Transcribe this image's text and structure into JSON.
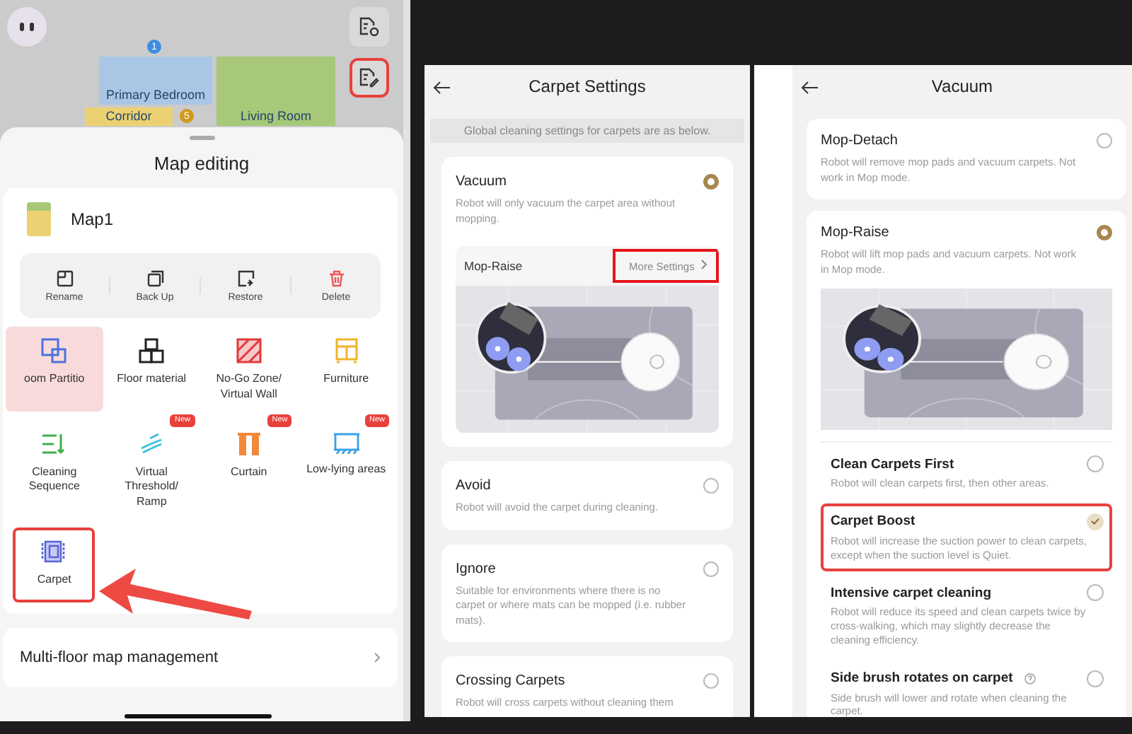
{
  "map_screen": {
    "rooms": [
      {
        "name": "Primary Bedroom",
        "color": "#a9c6e4"
      },
      {
        "name": "Corridor",
        "color": "#ecd172"
      },
      {
        "name": "Living Room",
        "color": "#a6c878"
      }
    ],
    "markers": [
      {
        "label": "1",
        "color": "#3d8ee0"
      },
      {
        "label": "5",
        "color": "#d09a1c"
      }
    ],
    "tools": [
      {
        "kind": "view",
        "highlighted": false
      },
      {
        "kind": "edit",
        "highlighted": true
      }
    ]
  },
  "sheet": {
    "title": "Map editing",
    "map_name": "Map1",
    "actions": [
      {
        "kind": "rename",
        "label": "Rename"
      },
      {
        "kind": "backup",
        "label": "Back Up"
      },
      {
        "kind": "restore",
        "label": "Restore"
      },
      {
        "kind": "delete",
        "label": "Delete"
      }
    ],
    "features": [
      {
        "kind": "partition",
        "label": "oom Partitio",
        "new": false,
        "obscured": true,
        "highlighted": false
      },
      {
        "kind": "floor",
        "label": "Floor material",
        "new": false,
        "obscured": false,
        "highlighted": false
      },
      {
        "kind": "nogo",
        "label": "No-Go Zone/ Virtual Wall",
        "new": false,
        "obscured": false,
        "highlighted": false
      },
      {
        "kind": "furniture",
        "label": "Furniture",
        "new": false,
        "obscured": false,
        "highlighted": false
      },
      {
        "kind": "sequence",
        "label": "Cleaning Sequence",
        "new": false,
        "obscured": false,
        "highlighted": false
      },
      {
        "kind": "threshold",
        "label": "Virtual Threshold/ Ramp",
        "new": true,
        "badge": "New",
        "obscured": false,
        "highlighted": false
      },
      {
        "kind": "curtain",
        "label": "Curtain",
        "new": true,
        "badge": "New",
        "obscured": false,
        "highlighted": false
      },
      {
        "kind": "lowlying",
        "label": "Low-lying areas",
        "new": true,
        "badge": "New",
        "obscured": false,
        "highlighted": false
      },
      {
        "kind": "carpet",
        "label": "Carpet",
        "new": false,
        "obscured": false,
        "highlighted": true
      }
    ],
    "footer": "Multi-floor map management"
  },
  "carpet_settings": {
    "title": "Carpet Settings",
    "notice": "Global cleaning settings for carpets are as below.",
    "options": [
      {
        "title": "Vacuum",
        "description": "Robot will only vacuum the carpet area without mopping.",
        "selected": true,
        "sub_setting": {
          "label": "Mop-Raise",
          "link": "More Settings",
          "highlighted": true
        }
      },
      {
        "title": "Avoid",
        "description": "Robot will avoid the carpet during cleaning.",
        "selected": false
      },
      {
        "title": "Ignore",
        "description": "Suitable for environments where there is no carpet or where mats can be mopped (i.e. rubber mats).",
        "selected": false
      },
      {
        "title": "Crossing Carpets",
        "description": "Robot will cross carpets without cleaning them",
        "selected": false
      }
    ]
  },
  "vacuum_settings": {
    "title": "Vacuum",
    "modes": [
      {
        "title": "Mop-Detach",
        "description": "Robot will remove mop pads and vacuum carpets. Not work in Mop mode.",
        "selected": false
      },
      {
        "title": "Mop-Raise",
        "description": "Robot will lift mop pads and vacuum carpets. Not work in Mop mode.",
        "selected": true
      }
    ],
    "carpet_options": [
      {
        "title": "Clean Carpets First",
        "description": "Robot will clean carpets first, then other areas.",
        "checked": false,
        "highlighted": false,
        "help": false
      },
      {
        "title": "Carpet Boost",
        "description": "Robot will increase the suction power to clean carpets, except when the suction level is Quiet.",
        "checked": true,
        "highlighted": true,
        "help": false
      },
      {
        "title": "Intensive carpet cleaning",
        "description": "Robot will reduce its speed and clean carpets twice by cross-walking, which may slightly decrease the cleaning efficiency.",
        "checked": false,
        "highlighted": false,
        "help": false
      },
      {
        "title": "Side brush rotates on carpet",
        "description": "Side brush will lower and rotate when cleaning the carpet.",
        "checked": false,
        "highlighted": false,
        "help": true
      }
    ]
  }
}
